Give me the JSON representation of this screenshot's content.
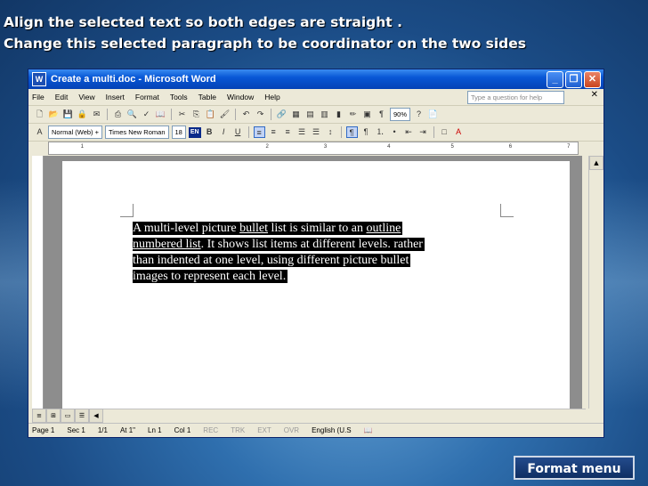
{
  "slide": {
    "title1": "Align the selected text so both edges are straight .",
    "title2": "Change this selected paragraph to be coordinator on the two sides",
    "format_button": "Format menu"
  },
  "window": {
    "title": "Create a multi.doc - Microsoft Word",
    "menu": [
      "File",
      "Edit",
      "View",
      "Insert",
      "Format",
      "Tools",
      "Table",
      "Window",
      "Help"
    ],
    "help_placeholder": "Type a question for help"
  },
  "toolbar": {
    "zoom": "90%",
    "style": "Normal (Web) +",
    "font": "Times New Roman",
    "size": "18",
    "lang": "EN",
    "bold": "B",
    "italic": "I",
    "underline": "U"
  },
  "ruler": {
    "marks": [
      "1",
      "2",
      "3",
      "4",
      "5",
      "6",
      "7"
    ]
  },
  "document": {
    "lines": [
      [
        "A multi-level picture ",
        {
          "u": "bullet"
        },
        " list is similar to an ",
        {
          "u": "outline"
        }
      ],
      [
        {
          "u": "numbered list"
        },
        ". It shows list items at different levels. rather"
      ],
      [
        "than indented at one level, using different picture bullet"
      ],
      [
        "images to represent each level. "
      ]
    ]
  },
  "statusbar": {
    "page": "Page  1",
    "sec": "Sec  1",
    "pages": "1/1",
    "at": "At  1\"",
    "ln": "Ln  1",
    "col": "Col  1",
    "rec": "REC",
    "trk": "TRK",
    "ext": "EXT",
    "ovr": "OVR",
    "lang": "English (U.S"
  }
}
